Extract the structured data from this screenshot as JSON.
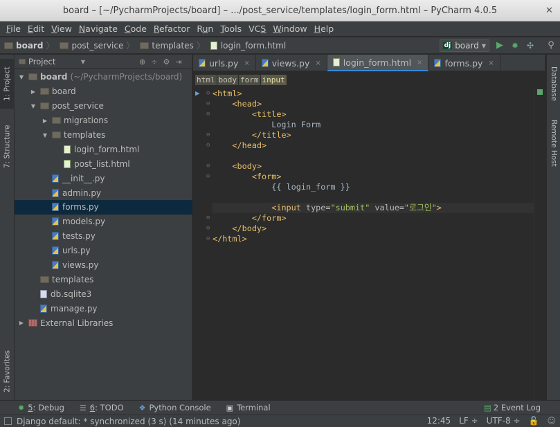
{
  "window": {
    "title": "board – [~/PycharmProjects/board] – .../post_service/templates/login_form.html – PyCharm 4.0.5",
    "close_glyph": "✕"
  },
  "menu": [
    "File",
    "Edit",
    "View",
    "Navigate",
    "Code",
    "Refactor",
    "Run",
    "Tools",
    "VCS",
    "Window",
    "Help"
  ],
  "menu_mnemonics": [
    "F",
    "E",
    "V",
    "N",
    "C",
    "R",
    "u",
    "T",
    "S",
    "W",
    "H"
  ],
  "breadcrumbs": [
    "board",
    "post_service",
    "templates",
    "login_form.html"
  ],
  "run_config": {
    "badge": "dj",
    "name": "board"
  },
  "icons": {
    "run": "run-icon",
    "debug": "debug-icon",
    "coverage": "coverage-icon",
    "search": "search-icon"
  },
  "left_tabs": {
    "project": "1: Project",
    "structure": "7: Structure",
    "favorites": "2: Favorites"
  },
  "right_tabs": {
    "database": "Database",
    "remote": "Remote Host"
  },
  "project_panel": {
    "selector": "Project",
    "tree": [
      {
        "label": "board",
        "muted": "(~/PycharmProjects/board)",
        "level": 0,
        "twisty": "down",
        "icon": "folder-dark"
      },
      {
        "label": "board",
        "level": 1,
        "twisty": "right",
        "icon": "folder-dark"
      },
      {
        "label": "post_service",
        "level": 1,
        "twisty": "down",
        "icon": "folder-dark"
      },
      {
        "label": "migrations",
        "level": 2,
        "twisty": "right",
        "icon": "folder-dark"
      },
      {
        "label": "templates",
        "level": 2,
        "twisty": "down",
        "icon": "folder-dark"
      },
      {
        "label": "login_form.html",
        "level": 3,
        "icon": "html"
      },
      {
        "label": "post_list.html",
        "level": 3,
        "icon": "html"
      },
      {
        "label": "__init__.py",
        "level": 2,
        "icon": "py"
      },
      {
        "label": "admin.py",
        "level": 2,
        "icon": "py"
      },
      {
        "label": "forms.py",
        "level": 2,
        "icon": "py",
        "selected": true
      },
      {
        "label": "models.py",
        "level": 2,
        "icon": "py"
      },
      {
        "label": "tests.py",
        "level": 2,
        "icon": "py"
      },
      {
        "label": "urls.py",
        "level": 2,
        "icon": "py"
      },
      {
        "label": "views.py",
        "level": 2,
        "icon": "py"
      },
      {
        "label": "templates",
        "level": 1,
        "icon": "folder-dark"
      },
      {
        "label": "db.sqlite3",
        "level": 1,
        "icon": "db"
      },
      {
        "label": "manage.py",
        "level": 1,
        "icon": "py"
      },
      {
        "label": "External Libraries",
        "level": 0,
        "twisty": "right",
        "icon": "lib"
      }
    ]
  },
  "editor_tabs": [
    {
      "label": "urls.py",
      "icon": "py"
    },
    {
      "label": "views.py",
      "icon": "py"
    },
    {
      "label": "login_form.html",
      "icon": "html",
      "active": true
    },
    {
      "label": "forms.py",
      "icon": "py"
    }
  ],
  "tag_path": [
    "html",
    "body",
    "form",
    "input"
  ],
  "code_lines": [
    "<html>",
    "    <head>",
    "        <title>",
    "            Login Form",
    "        </title>",
    "    </head>",
    "",
    "    <body>",
    "        <form>",
    "            {{ login_form }}",
    "",
    "            <input type=\"submit\" value=\"로그인\">",
    "        </form>",
    "    </body>",
    "</html>"
  ],
  "tool_windows": [
    {
      "num": "5",
      "label": ": Debug"
    },
    {
      "num": "6",
      "label": ": TODO"
    },
    {
      "num": "",
      "label": "Python Console"
    },
    {
      "num": "",
      "label": "Terminal"
    }
  ],
  "event_log": {
    "count": "2",
    "label": "Event Log"
  },
  "status": {
    "message": "Django default: * synchronized (3 s) (14 minutes ago)",
    "position": "12:45",
    "line_sep": "LF",
    "encoding": "UTF-8"
  }
}
